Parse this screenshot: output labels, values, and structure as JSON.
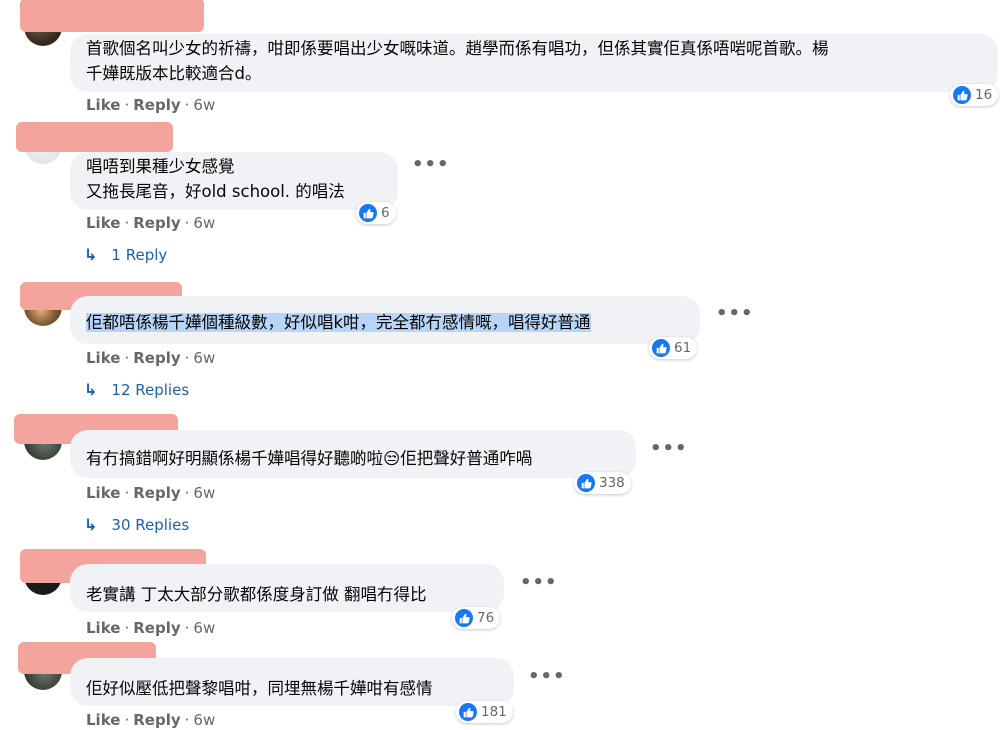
{
  "ui": {
    "like_color": "#1877f2",
    "highlight_color": "#b7d5f7",
    "redaction_color": "#f3a49c"
  },
  "action_labels": {
    "like": "Like",
    "reply": "Reply",
    "sep": "·"
  },
  "comments": [
    {
      "lines": [
        "首歌個名叫少女的祈禱，咁即係要唱出少女嘅味道。趙學而係有唱功，但係其實佢真係唔啱呢首歌。楊",
        "千嬅既版本比較適合d。"
      ],
      "likes": "16",
      "time": "6w",
      "replies": ""
    },
    {
      "lines": [
        "唱唔到果種少女感覺",
        "又拖長尾音，好old school. 的唱法"
      ],
      "likes": "6",
      "time": "6w",
      "replies": "1 Reply"
    },
    {
      "lines": [
        "佢都唔係楊千嬅個種級數，好似唱k咁，完全都冇感情嘅，唱得好普通"
      ],
      "likes": "61",
      "time": "6w",
      "replies": "12 Replies",
      "highlighted": true
    },
    {
      "lines": [
        "有冇搞錯啊好明顯係楊千嬅唱得好聽啲啦😒佢把聲好普通咋喎"
      ],
      "likes": "338",
      "time": "6w",
      "replies": "30 Replies"
    },
    {
      "lines": [
        "老實講 丁太大部分歌都係度身訂做 翻唱冇得比"
      ],
      "likes": "76",
      "time": "6w",
      "replies": ""
    },
    {
      "lines": [
        "佢好似壓低把聲黎唱咁，同埋無楊千嬅咁有感情"
      ],
      "likes": "181",
      "time": "6w",
      "replies": ""
    }
  ]
}
